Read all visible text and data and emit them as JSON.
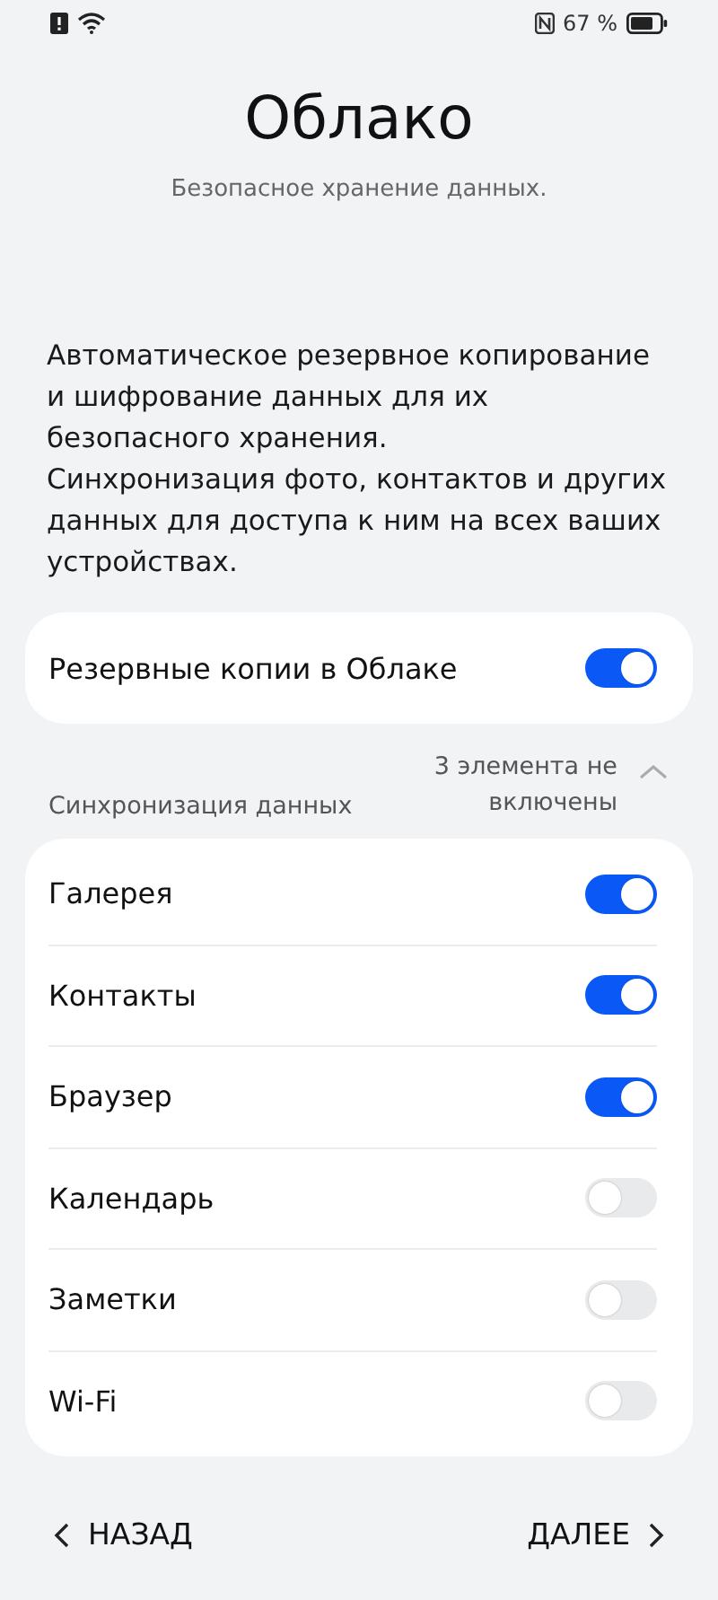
{
  "status_bar": {
    "battery_text": "67 %"
  },
  "title": "Облако",
  "subtitle": "Безопасное хранение данных.",
  "description": [
    "Автоматическое резервное копирование и шифрование данных для их безопасного хранения.",
    "Синхронизация фото, контактов и других данных для доступа к ним на всех ваших устройствах."
  ],
  "backup": {
    "label": "Резервные копии в Облаке",
    "on": true
  },
  "sync_section": {
    "title": "Синхронизация данных",
    "summary": "3 элемента не включены",
    "expanded": true
  },
  "sync_items": [
    {
      "label": "Галерея",
      "on": true
    },
    {
      "label": "Контакты",
      "on": true
    },
    {
      "label": "Браузер",
      "on": true
    },
    {
      "label": "Календарь",
      "on": false
    },
    {
      "label": "Заметки",
      "on": false
    },
    {
      "label": "Wi-Fi",
      "on": false
    }
  ],
  "footer": {
    "back": "НАЗАД",
    "next": "ДАЛЕЕ"
  }
}
